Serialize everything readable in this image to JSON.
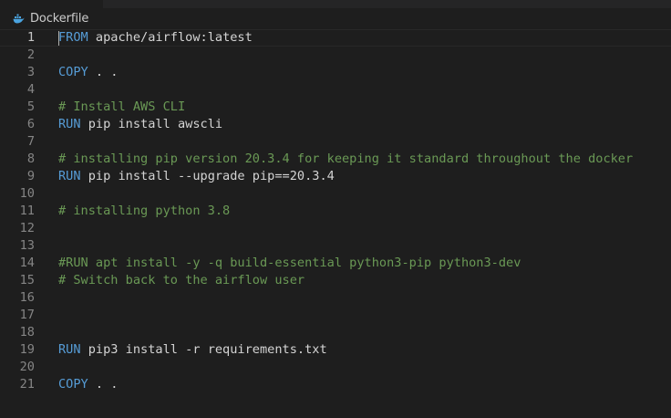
{
  "tab": {
    "file_name": "Dockerfile",
    "icon": "docker-whale-icon"
  },
  "colors": {
    "keyword": "#569cd6",
    "comment": "#6a9955",
    "text": "#d4d4d4",
    "line_number": "#858585",
    "background": "#1e1e1e"
  },
  "editor": {
    "current_line": 1,
    "lines": [
      {
        "num": "1",
        "kw": "FROM",
        "rest": " apache/airflow:latest",
        "comment": ""
      },
      {
        "num": "2",
        "kw": "",
        "rest": "",
        "comment": ""
      },
      {
        "num": "3",
        "kw": "COPY",
        "rest": " . .",
        "comment": ""
      },
      {
        "num": "4",
        "kw": "",
        "rest": "",
        "comment": ""
      },
      {
        "num": "5",
        "kw": "",
        "rest": "",
        "comment": "# Install AWS CLI"
      },
      {
        "num": "6",
        "kw": "RUN",
        "rest": " pip install awscli",
        "comment": ""
      },
      {
        "num": "7",
        "kw": "",
        "rest": "",
        "comment": ""
      },
      {
        "num": "8",
        "kw": "",
        "rest": "",
        "comment": "# installing pip version 20.3.4 for keeping it standard throughout the docker"
      },
      {
        "num": "9",
        "kw": "RUN",
        "rest": " pip install --upgrade pip==20.3.4",
        "comment": ""
      },
      {
        "num": "10",
        "kw": "",
        "rest": "",
        "comment": ""
      },
      {
        "num": "11",
        "kw": "",
        "rest": "",
        "comment": "# installing python 3.8"
      },
      {
        "num": "12",
        "kw": "",
        "rest": "",
        "comment": ""
      },
      {
        "num": "13",
        "kw": "",
        "rest": "",
        "comment": ""
      },
      {
        "num": "14",
        "kw": "",
        "rest": "",
        "comment": "#RUN apt install -y -q build-essential python3-pip python3-dev"
      },
      {
        "num": "15",
        "kw": "",
        "rest": "",
        "comment": "# Switch back to the airflow user"
      },
      {
        "num": "16",
        "kw": "",
        "rest": "",
        "comment": ""
      },
      {
        "num": "17",
        "kw": "",
        "rest": "",
        "comment": ""
      },
      {
        "num": "18",
        "kw": "",
        "rest": "",
        "comment": ""
      },
      {
        "num": "19",
        "kw": "RUN",
        "rest": " pip3 install -r requirements.txt",
        "comment": ""
      },
      {
        "num": "20",
        "kw": "",
        "rest": "",
        "comment": ""
      },
      {
        "num": "21",
        "kw": "COPY",
        "rest": " . .",
        "comment": ""
      }
    ]
  }
}
